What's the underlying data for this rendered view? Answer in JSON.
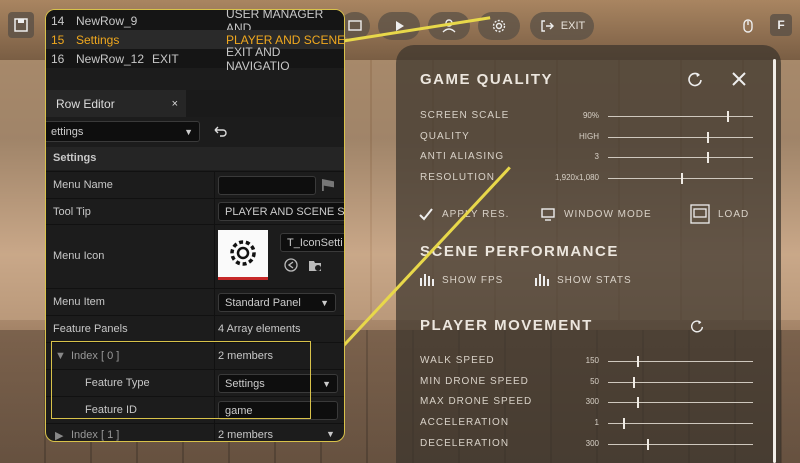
{
  "toolbar": {
    "exit_label": "EXIT",
    "f_key": "F"
  },
  "game_quality": {
    "title": "GAME QUALITY",
    "items": [
      {
        "label": "SCREEN SCALE",
        "value": "90%",
        "level": 0.82
      },
      {
        "label": "QUALITY",
        "value": "HIGH",
        "level": 0.68
      },
      {
        "label": "ANTI ALIASING",
        "value": "3",
        "level": 0.68
      },
      {
        "label": "RESOLUTION",
        "value": "1,920x1,080",
        "level": 0.5
      }
    ],
    "apply_label": "APPLY RES.",
    "window_mode_label": "WINDOW MODE",
    "load_label": "LOAD"
  },
  "scene_performance": {
    "title": "SCENE PERFORMANCE",
    "show_fps_label": "SHOW FPS",
    "show_stats_label": "SHOW STATS"
  },
  "player_movement": {
    "title": "PLAYER MOVEMENT",
    "items": [
      {
        "label": "WALK SPEED",
        "value": "150",
        "level": 0.2
      },
      {
        "label": "MIN DRONE SPEED",
        "value": "50",
        "level": 0.17
      },
      {
        "label": "MAX DRONE SPEED",
        "value": "300",
        "level": 0.2
      },
      {
        "label": "ACCELERATION",
        "value": "1",
        "level": 0.1
      },
      {
        "label": "DECELERATION",
        "value": "300",
        "level": 0.27
      }
    ]
  },
  "editor": {
    "rows": [
      {
        "num": "14",
        "name": "NewRow_9",
        "extra": "",
        "desc": "USER MANAGER AND"
      },
      {
        "num": "15",
        "name": "Settings",
        "extra": "",
        "desc": "PLAYER AND SCENE"
      },
      {
        "num": "16",
        "name": "NewRow_12",
        "extra": "EXIT",
        "desc": "EXIT AND NAVIGATIO"
      }
    ],
    "tab_label": "Row Editor",
    "tab_close": "×",
    "row_select": "ettings",
    "section": "Settings",
    "menu_name_label": "Menu Name",
    "tooltip_label": "Tool Tip",
    "tooltip_value": "PLAYER AND SCENE SE",
    "menu_icon_label": "Menu Icon",
    "icon_asset": "T_IconSetti",
    "menu_item_label": "Menu Item",
    "menu_item_value": "Standard Panel",
    "feature_panels_label": "Feature Panels",
    "feature_panels_value": "4 Array elements",
    "index0_label": "Index [ 0 ]",
    "index0_value": "2 members",
    "feature_type_label": "Feature Type",
    "feature_type_value": "Settings",
    "feature_id_label": "Feature ID",
    "feature_id_value": "game",
    "index1_label": "Index [ 1 ]",
    "index1_value": "2 members"
  },
  "colors": {
    "accent": "#d8c24a",
    "selected_row": "#f0a81e"
  }
}
